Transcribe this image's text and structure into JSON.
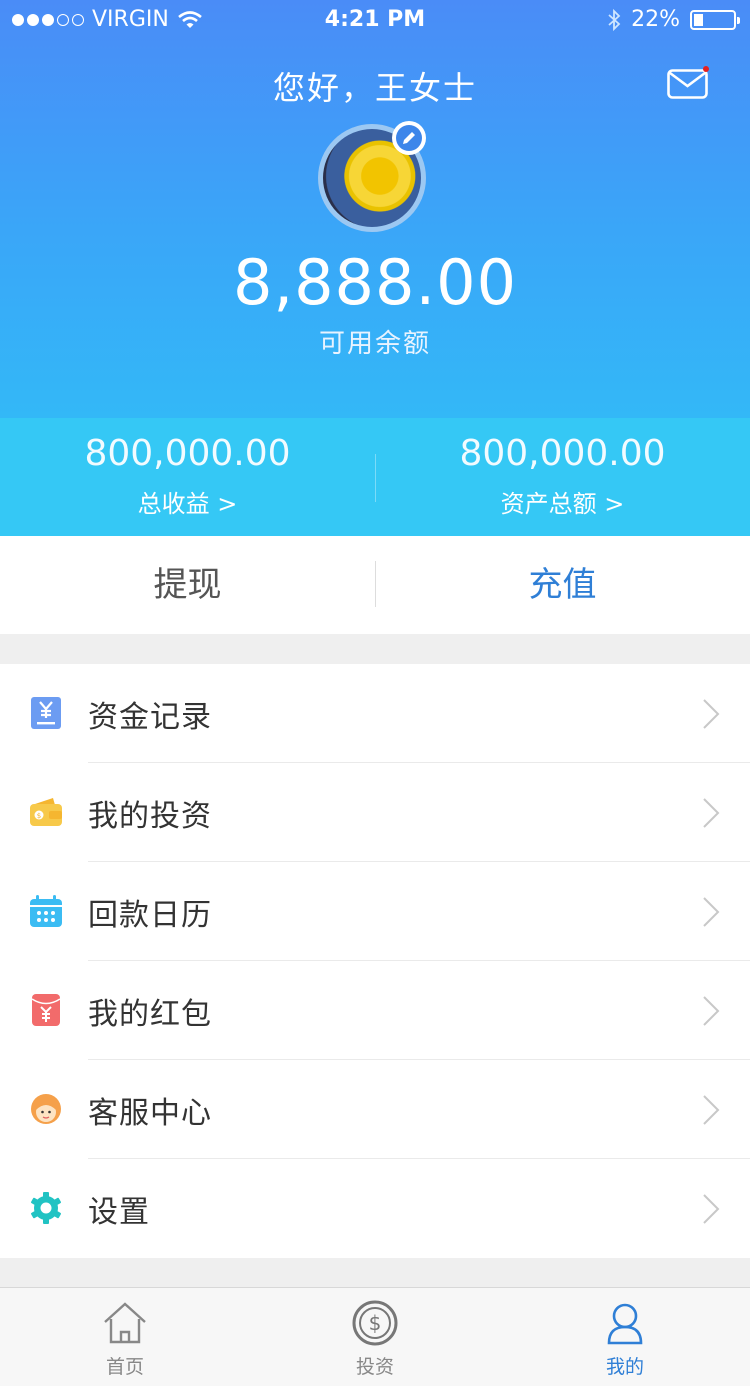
{
  "status_bar": {
    "carrier": "VIRGIN",
    "time": "4:21 PM",
    "battery": "22%"
  },
  "header": {
    "greeting": "您好，王女士",
    "balance": "8,888.00",
    "balance_label": "可用余额"
  },
  "stats": [
    {
      "value": "800,000.00",
      "label": "总收益 >"
    },
    {
      "value": "800,000.00",
      "label": "资产总额 >"
    }
  ],
  "actions": {
    "withdraw": "提现",
    "recharge": "充值"
  },
  "menu": [
    {
      "label": "资金记录",
      "icon": "fund-record-icon",
      "color": "#6c9cf2"
    },
    {
      "label": "我的投资",
      "icon": "wallet-icon",
      "color": "#f7c94a"
    },
    {
      "label": "回款日历",
      "icon": "calendar-icon",
      "color": "#3bbcf3"
    },
    {
      "label": "我的红包",
      "icon": "red-packet-icon",
      "color": "#f26b6b"
    },
    {
      "label": "客服中心",
      "icon": "customer-service-icon",
      "color": "#f5a04a"
    },
    {
      "label": "设置",
      "icon": "settings-icon",
      "color": "#21c3c3"
    }
  ],
  "tabbar": [
    {
      "label": "首页",
      "icon": "home-icon",
      "active": false
    },
    {
      "label": "投资",
      "icon": "invest-icon",
      "active": false
    },
    {
      "label": "我的",
      "icon": "profile-icon",
      "active": true
    }
  ],
  "colors": {
    "accent": "#2f7fd6",
    "header_top": "#4a8cf7",
    "stats_bg": "#35c8f5",
    "notify_dot": "#e62020"
  }
}
